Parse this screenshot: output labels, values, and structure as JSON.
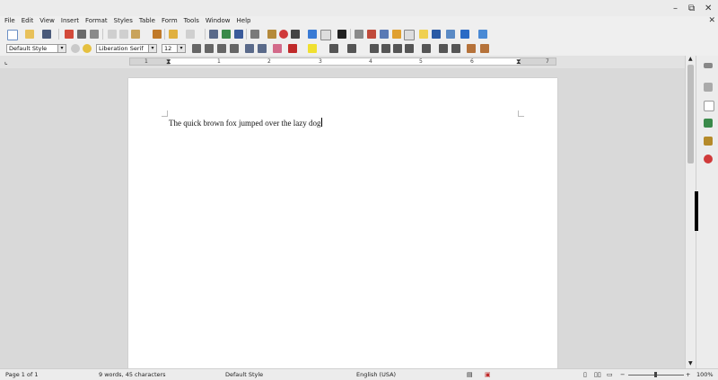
{
  "window": {
    "minimize": "–",
    "restore": "⧉",
    "close": "✕",
    "doc_close": "✕"
  },
  "menubar": {
    "items": [
      "File",
      "Edit",
      "View",
      "Insert",
      "Format",
      "Styles",
      "Table",
      "Form",
      "Tools",
      "Window",
      "Help"
    ]
  },
  "formatting": {
    "paragraph_style": "Default Style",
    "font_name": "Liberation Serif",
    "font_size": "12"
  },
  "ruler": {
    "numbers": [
      "1",
      "1",
      "2",
      "3",
      "4",
      "5",
      "6",
      "7"
    ]
  },
  "document": {
    "text": "The quick brown fox jumped over the lazy dog"
  },
  "statusbar": {
    "page": "Page 1 of 1",
    "words": "9 words, 45 characters",
    "page_style": "Default Style",
    "language": "English (USA)",
    "zoom": "100%"
  },
  "colors": {
    "accent": "#3a7bd5",
    "bg": "#d9d9d9",
    "toolbar": "#efefef"
  }
}
